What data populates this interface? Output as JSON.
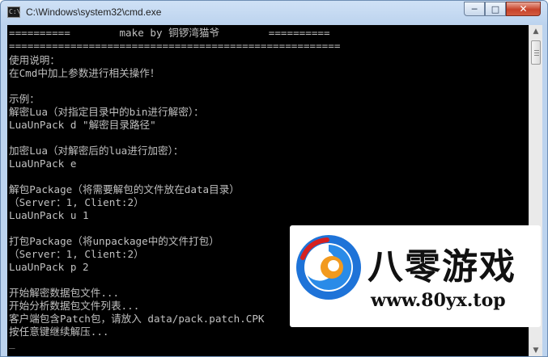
{
  "window": {
    "title": "C:\\Windows\\system32\\cmd.exe",
    "icon_text": "C:\\",
    "icon": "cmd-icon"
  },
  "controls": {
    "minimize": "─",
    "maximize": "□",
    "close": "✕"
  },
  "console": {
    "header1": "==========        make by 铜锣湾猫爷        ==========",
    "header2": "======================================================",
    "lines": [
      "使用说明：",
      "在Cmd中加上参数进行相关操作！",
      "",
      "示例：",
      "解密Lua（对指定目录中的bin进行解密）：",
      "LuaUnPack d \"解密目录路径\"",
      "",
      "加密Lua（对解密后的lua进行加密）：",
      "LuaUnPack e",
      "",
      "解包Package（将需要解包的文件放在data目录）",
      "（Server：1, Client:2）",
      "LuaUnPack u 1",
      "",
      "打包Package（将unpackage中的文件打包）",
      "（Server：1, Client:2）",
      "LuaUnPack p 2",
      "",
      "开始解密数据包文件...",
      "开始分析数据包文件列表...",
      "客户端包含Patch包，请放入 data/pack.patch.CPK",
      "按任意键继续解压..."
    ],
    "cursor": "_"
  },
  "scrollbar": {
    "up": "▲",
    "down": "▼"
  },
  "watermark": {
    "brand": "八零游戏",
    "url": "www.80yx.top"
  }
}
